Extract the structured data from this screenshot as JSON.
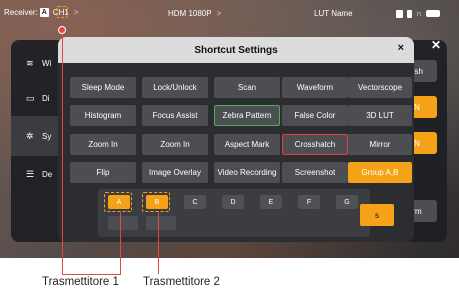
{
  "statusbar": {
    "receiver": "Receiver:",
    "receiver_badge": "A",
    "channel": "CH1",
    "channel_chevron": ">",
    "hdmi": "HDM 1080P",
    "hdmi_chevron": ">",
    "lut": "LUT Name",
    "icons": [
      "record-icon",
      "sd-card-icon",
      "headphone-icon",
      "battery-icon"
    ]
  },
  "sidebar": {
    "items": [
      {
        "label": "Wi",
        "icon": "wifi-icon"
      },
      {
        "label": "Di",
        "icon": "display-icon"
      },
      {
        "label": "Sy",
        "icon": "gear-icon"
      },
      {
        "label": "De",
        "icon": "device-icon"
      }
    ],
    "right_items": [
      "lish",
      "N",
      "N",
      "rm"
    ]
  },
  "dialog": {
    "title": "Shortcut Settings",
    "close": "×",
    "rows": [
      [
        "Sleep Mode",
        "Lock/Unlock",
        "Scan",
        "Waveform",
        "Vectorscope"
      ],
      [
        "Histogram",
        "Focus Assist",
        "Zebra Pattern",
        "False Color",
        "3D LUT"
      ],
      [
        "Zoom In",
        "Zoom In",
        "Aspect Mark",
        "Crosshatch",
        "Mirror"
      ],
      [
        "Flip",
        "Image Overlay",
        "Video Recording",
        "Screenshot",
        "Group A,B"
      ]
    ],
    "group_letters": [
      "A",
      "B",
      "C",
      "D",
      "E",
      "F",
      "G"
    ],
    "right_button": "s"
  },
  "annotations": {
    "label1": "Trasmettitore 1",
    "label2": "Trasmettitore 2"
  },
  "colors": {
    "accent": "#f5a219",
    "callout": "#e04848",
    "zebra_border": "#4caf50",
    "crosshatch_border": "#e04040"
  }
}
